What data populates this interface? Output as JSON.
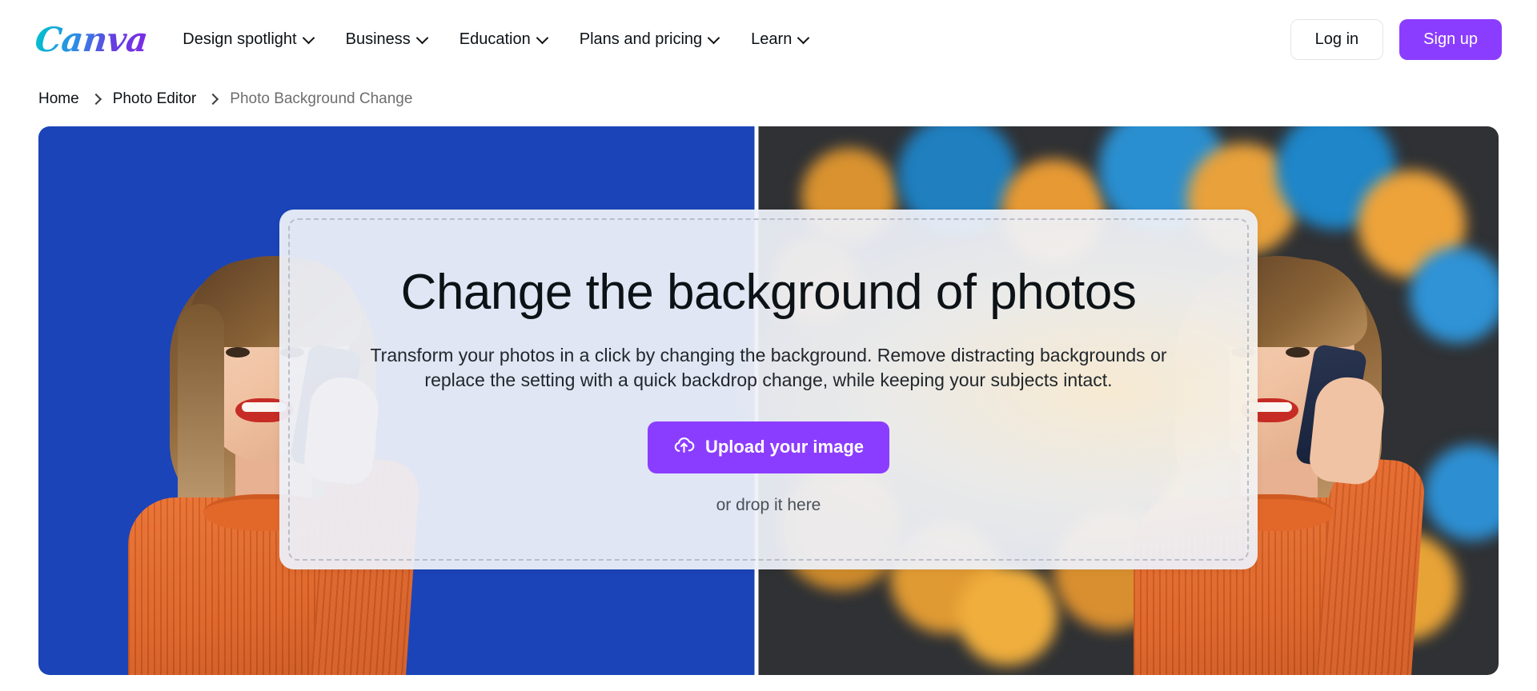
{
  "header": {
    "logo_text": "Canva",
    "nav_items": [
      {
        "label": "Design spotlight",
        "icon": "chevron-down-icon"
      },
      {
        "label": "Business",
        "icon": "chevron-down-icon"
      },
      {
        "label": "Education",
        "icon": "chevron-down-icon"
      },
      {
        "label": "Plans and pricing",
        "icon": "chevron-down-icon"
      },
      {
        "label": "Learn",
        "icon": "chevron-down-icon"
      }
    ],
    "login_label": "Log in",
    "signup_label": "Sign up"
  },
  "breadcrumb": {
    "items": [
      {
        "label": "Home",
        "current": false
      },
      {
        "label": "Photo Editor",
        "current": false
      },
      {
        "label": "Photo Background Change",
        "current": true
      }
    ],
    "separator_icon": "chevron-right-icon"
  },
  "hero": {
    "left_background_color": "#1b44b8",
    "right_background_color": "#2f3134",
    "subject_description": "Smiling woman in an orange ribbed sweater talking on a dark blue phone"
  },
  "drop_panel": {
    "title": "Change the background of photos",
    "subtitle": "Transform your photos in a click by changing the background. Remove distracting backgrounds or replace the setting with a quick backdrop change, while keeping your subjects intact.",
    "upload_label": "Upload your image",
    "upload_icon": "cloud-upload-icon",
    "drop_hint": "or drop it here"
  },
  "colors": {
    "brand_purple": "#8b3dff",
    "logo_gradient_start": "#00c4cc",
    "logo_gradient_end": "#7d2ae8",
    "hero_blue": "#1b44b8",
    "hero_dark": "#2f3134",
    "sweater_orange": "#e2682a",
    "text_dark": "#0d1216",
    "text_muted": "#6e6e6e"
  }
}
